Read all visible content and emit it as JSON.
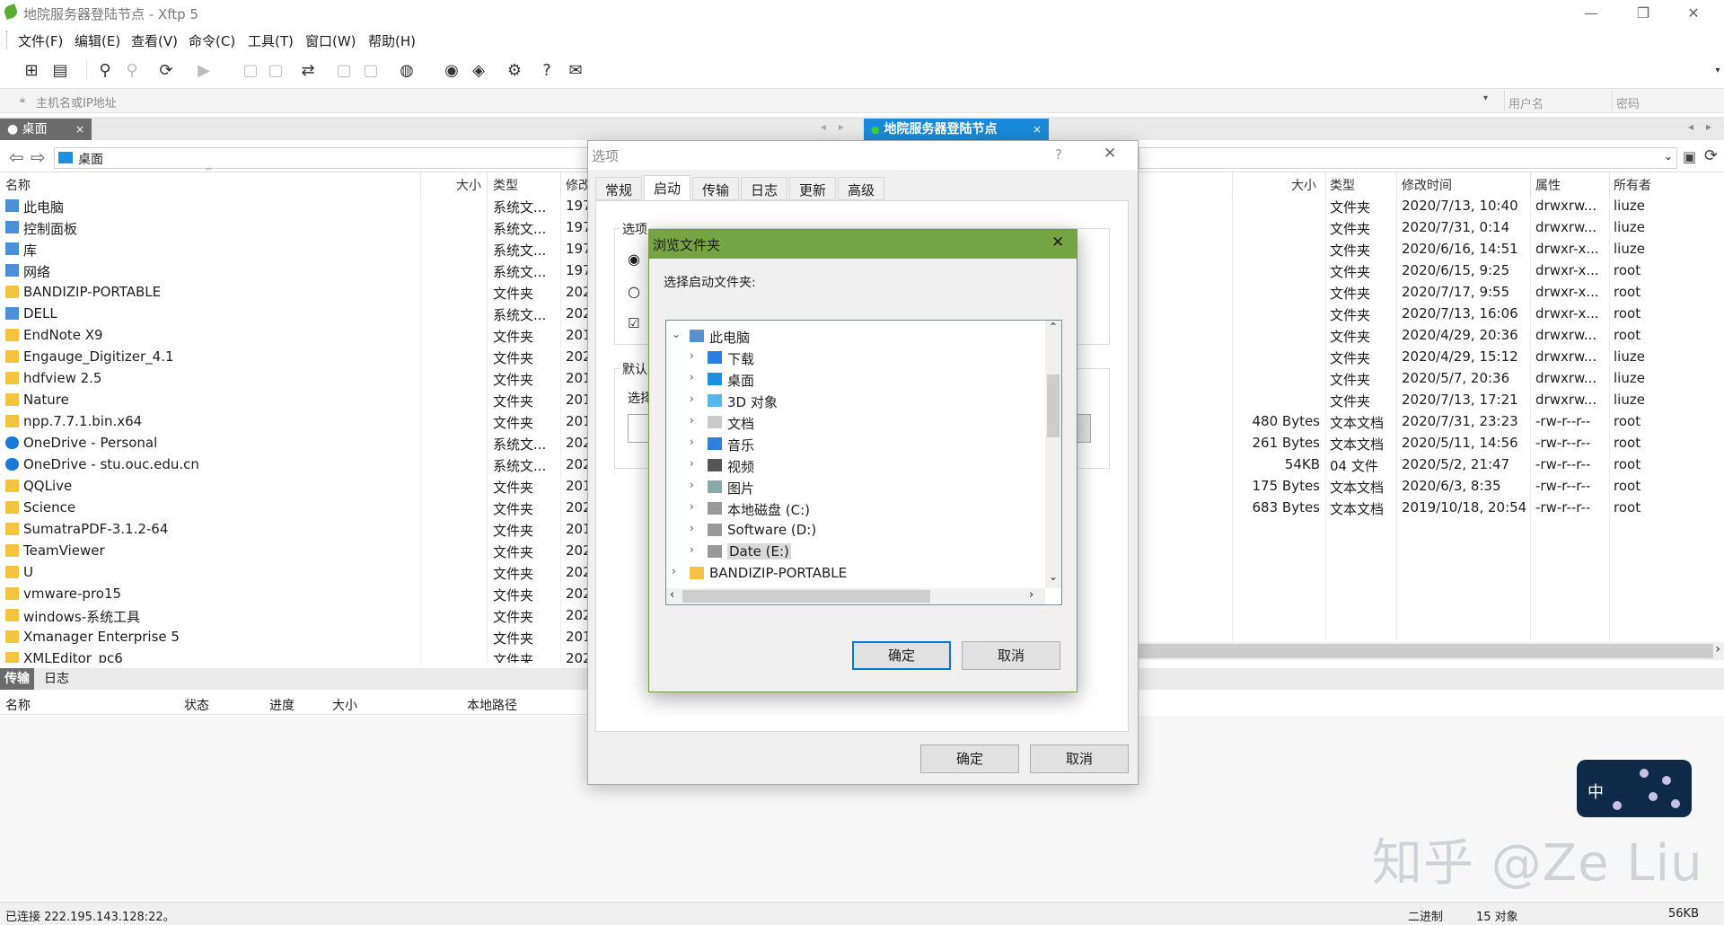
{
  "window": {
    "title": "地院服务器登陆节点 - Xftp 5"
  },
  "menu": [
    "文件(F)",
    "编辑(E)",
    "查看(V)",
    "命令(C)",
    "工具(T)",
    "窗口(W)",
    "帮助(H)"
  ],
  "address": {
    "host_placeholder": "主机名或IP地址",
    "user_placeholder": "用户名",
    "password_placeholder": "密码"
  },
  "tabs": {
    "local": "桌面",
    "remote": "地院服务器登陆节点"
  },
  "local": {
    "path": "桌面",
    "columns": {
      "name": "名称",
      "size": "大小",
      "type": "类型",
      "modified": "修改"
    },
    "rows": [
      {
        "name": "此电脑",
        "type": "系统文...",
        "mod": "197",
        "icon": "computer-icon"
      },
      {
        "name": "控制面板",
        "type": "系统文...",
        "mod": "197",
        "icon": "control-panel-icon"
      },
      {
        "name": "库",
        "type": "系统文...",
        "mod": "197",
        "icon": "library-icon"
      },
      {
        "name": "网络",
        "type": "系统文...",
        "mod": "197",
        "icon": "network-icon"
      },
      {
        "name": "BANDIZIP-PORTABLE",
        "type": "文件夹",
        "mod": "202",
        "icon": "folder-icon"
      },
      {
        "name": "DELL",
        "type": "系统文...",
        "mod": "202",
        "icon": "user-icon"
      },
      {
        "name": "EndNote X9",
        "type": "文件夹",
        "mod": "201",
        "icon": "folder-icon"
      },
      {
        "name": "Engauge_Digitizer_4.1",
        "type": "文件夹",
        "mod": "202",
        "icon": "folder-icon"
      },
      {
        "name": "hdfview 2.5",
        "type": "文件夹",
        "mod": "201",
        "icon": "folder-icon"
      },
      {
        "name": "Nature",
        "type": "文件夹",
        "mod": "201",
        "icon": "folder-icon"
      },
      {
        "name": "npp.7.7.1.bin.x64",
        "type": "文件夹",
        "mod": "201",
        "icon": "folder-icon"
      },
      {
        "name": "OneDrive - Personal",
        "type": "系统文...",
        "mod": "202",
        "icon": "cloud-icon"
      },
      {
        "name": "OneDrive - stu.ouc.edu.cn",
        "type": "系统文...",
        "mod": "202",
        "icon": "cloud-icon"
      },
      {
        "name": "QQLive",
        "type": "文件夹",
        "mod": "201",
        "icon": "folder-icon"
      },
      {
        "name": "Science",
        "type": "文件夹",
        "mod": "202",
        "icon": "folder-icon"
      },
      {
        "name": "SumatraPDF-3.1.2-64",
        "type": "文件夹",
        "mod": "201",
        "icon": "folder-icon"
      },
      {
        "name": "TeamViewer",
        "type": "文件夹",
        "mod": "202",
        "icon": "folder-icon"
      },
      {
        "name": "U",
        "type": "文件夹",
        "mod": "202",
        "icon": "folder-icon"
      },
      {
        "name": "vmware-pro15",
        "type": "文件夹",
        "mod": "202",
        "icon": "folder-icon"
      },
      {
        "name": "windows-系统工具",
        "type": "文件夹",
        "mod": "202",
        "icon": "folder-icon"
      },
      {
        "name": "Xmanager Enterprise 5",
        "type": "文件夹",
        "mod": "201",
        "icon": "folder-icon"
      },
      {
        "name": "XMLEditor_pc6",
        "type": "文件夹",
        "mod": "202",
        "icon": "folder-icon"
      }
    ]
  },
  "remote": {
    "columns": {
      "size": "大小",
      "type": "类型",
      "modified": "修改时间",
      "attr": "属性",
      "owner": "所有者"
    },
    "rows": [
      {
        "size": "",
        "type": "文件夹",
        "mod": "2020/7/13, 10:40",
        "attr": "drwxrw...",
        "owner": "liuze"
      },
      {
        "size": "",
        "type": "文件夹",
        "mod": "2020/7/31, 0:14",
        "attr": "drwxrw...",
        "owner": "liuze"
      },
      {
        "size": "",
        "type": "文件夹",
        "mod": "2020/6/16, 14:51",
        "attr": "drwxr-x...",
        "owner": "liuze"
      },
      {
        "size": "",
        "type": "文件夹",
        "mod": "2020/6/15, 9:25",
        "attr": "drwxr-x...",
        "owner": "root"
      },
      {
        "size": "",
        "type": "文件夹",
        "mod": "2020/7/17, 9:55",
        "attr": "drwxr-x...",
        "owner": "root"
      },
      {
        "size": "",
        "type": "文件夹",
        "mod": "2020/7/13, 16:06",
        "attr": "drwxr-x...",
        "owner": "root"
      },
      {
        "size": "",
        "type": "文件夹",
        "mod": "2020/4/29, 20:36",
        "attr": "drwxrw...",
        "owner": "root"
      },
      {
        "size": "",
        "type": "文件夹",
        "mod": "2020/4/29, 15:12",
        "attr": "drwxrw...",
        "owner": "liuze"
      },
      {
        "size": "",
        "type": "文件夹",
        "mod": "2020/5/7, 20:36",
        "attr": "drwxrw...",
        "owner": "liuze"
      },
      {
        "size": "",
        "type": "文件夹",
        "mod": "2020/7/13, 17:21",
        "attr": "drwxrw...",
        "owner": "liuze"
      },
      {
        "size": "480 Bytes",
        "type": "文本文档",
        "mod": "2020/7/31, 23:23",
        "attr": "-rw-r--r--",
        "owner": "root"
      },
      {
        "size": "261 Bytes",
        "type": "文本文档",
        "mod": "2020/5/11, 14:56",
        "attr": "-rw-r--r--",
        "owner": "root"
      },
      {
        "size": "54KB",
        "type": "04 文件",
        "mod": "2020/5/2, 21:47",
        "attr": "-rw-r--r--",
        "owner": "root"
      },
      {
        "size": "175 Bytes",
        "type": "文本文档",
        "mod": "2020/6/3, 8:35",
        "attr": "-rw-r--r--",
        "owner": "root"
      },
      {
        "size": "683 Bytes",
        "type": "文本文档",
        "mod": "2019/10/18, 20:54",
        "attr": "-rw-r--r--",
        "owner": "root"
      }
    ]
  },
  "transfer": {
    "tabs": [
      "传输",
      "日志"
    ],
    "columns": {
      "name": "名称",
      "status": "状态",
      "progress": "进度",
      "size": "大小",
      "local_path": "本地路径"
    }
  },
  "options_dialog": {
    "title": "选项",
    "help": "?",
    "tabs": [
      "常规",
      "启动",
      "传输",
      "日志",
      "更新",
      "高级"
    ],
    "group1_label": "选项",
    "group2_label": "默认",
    "select_label": "选择",
    "ok": "确定",
    "cancel": "取消"
  },
  "browse_dialog": {
    "title": "浏览文件夹",
    "prompt": "选择启动文件夹:",
    "tree": [
      {
        "label": "此电脑",
        "level": 0,
        "expanded": true,
        "icon": "computer-icon"
      },
      {
        "label": "下载",
        "level": 1,
        "icon": "download-icon"
      },
      {
        "label": "桌面",
        "level": 1,
        "icon": "desktop-icon"
      },
      {
        "label": "3D 对象",
        "level": 1,
        "icon": "cube-icon"
      },
      {
        "label": "文档",
        "level": 1,
        "icon": "document-icon"
      },
      {
        "label": "音乐",
        "level": 1,
        "icon": "music-icon"
      },
      {
        "label": "视频",
        "level": 1,
        "icon": "video-icon"
      },
      {
        "label": "图片",
        "level": 1,
        "icon": "picture-icon"
      },
      {
        "label": "本地磁盘 (C:)",
        "level": 1,
        "icon": "drive-icon"
      },
      {
        "label": "Software (D:)",
        "level": 1,
        "icon": "drive-icon"
      },
      {
        "label": "Date (E:)",
        "level": 1,
        "icon": "drive-icon",
        "selected": true
      },
      {
        "label": "BANDIZIP-PORTABLE",
        "level": 0,
        "icon": "folder-icon"
      }
    ],
    "ok": "确定",
    "cancel": "取消"
  },
  "status": {
    "left": "已连接 222.195.143.128:22。",
    "mode": "二进制",
    "count": "15 对象",
    "size": "56KB"
  },
  "ime": {
    "label": "中"
  },
  "watermark": "知乎 @Ze Liu"
}
